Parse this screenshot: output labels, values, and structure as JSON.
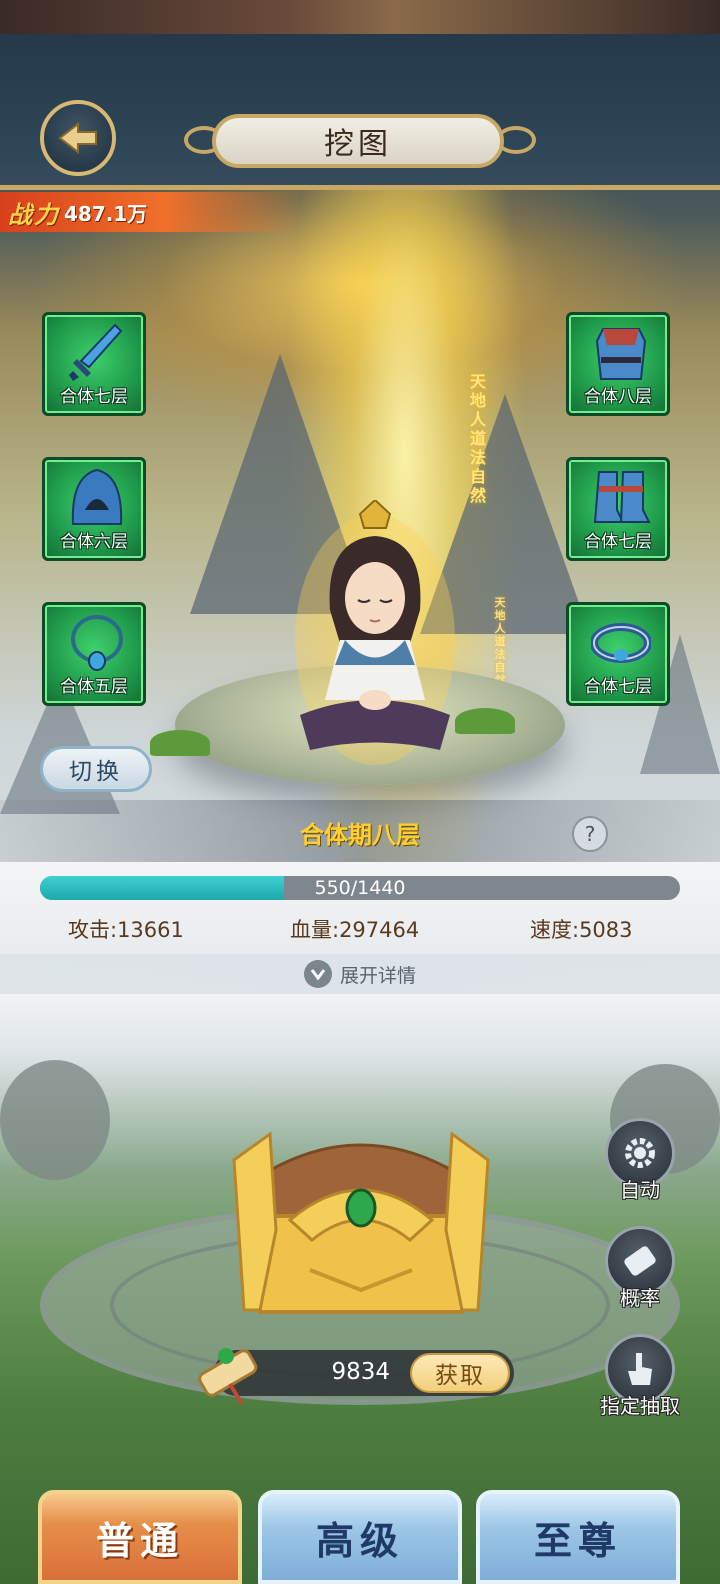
{
  "header": {
    "title": "挖图"
  },
  "power": {
    "label": "战力",
    "value": "487.1万"
  },
  "scene_text": {
    "vertical_big": [
      "天",
      "地",
      "人",
      "道",
      "法",
      "自",
      "然"
    ],
    "vertical_small": [
      "天",
      "地",
      "人",
      "道",
      "法",
      "自",
      "然"
    ]
  },
  "equipment": [
    {
      "name": "weapon",
      "label": "合体七层"
    },
    {
      "name": "armor",
      "label": "合体八层"
    },
    {
      "name": "helmet",
      "label": "合体六层"
    },
    {
      "name": "boots",
      "label": "合体七层"
    },
    {
      "name": "necklace",
      "label": "合体五层"
    },
    {
      "name": "belt",
      "label": "合体七层"
    }
  ],
  "switch_label": "切换",
  "realm": {
    "name": "合体期八层",
    "help": "?",
    "xp_text": "550/1440",
    "xp_current": 550,
    "xp_max": 1440
  },
  "stats": {
    "attack": "攻击:13661",
    "hp": "血量:297464",
    "speed": "速度:5083"
  },
  "expand_label": "展开详情",
  "side_buttons": {
    "auto": "自动",
    "probability": "概率",
    "specify": "指定抽取"
  },
  "scrolls": {
    "count": "9834",
    "get_label": "获取"
  },
  "tabs": [
    "普通",
    "高级",
    "至尊"
  ],
  "colors": {
    "accent_gold": "#c9a866",
    "equip_green": "#1f9a4a",
    "xp_teal": "#1ea8ab",
    "active_tab": "#d9703a",
    "inactive_tab": "#7faed8"
  },
  "icons": {
    "back": "back-arrow-icon",
    "help": "question-icon",
    "expand": "chevron-down-icon",
    "auto": "gear-icon",
    "probability": "scroll-icon",
    "specify": "hand-pointer-icon"
  }
}
